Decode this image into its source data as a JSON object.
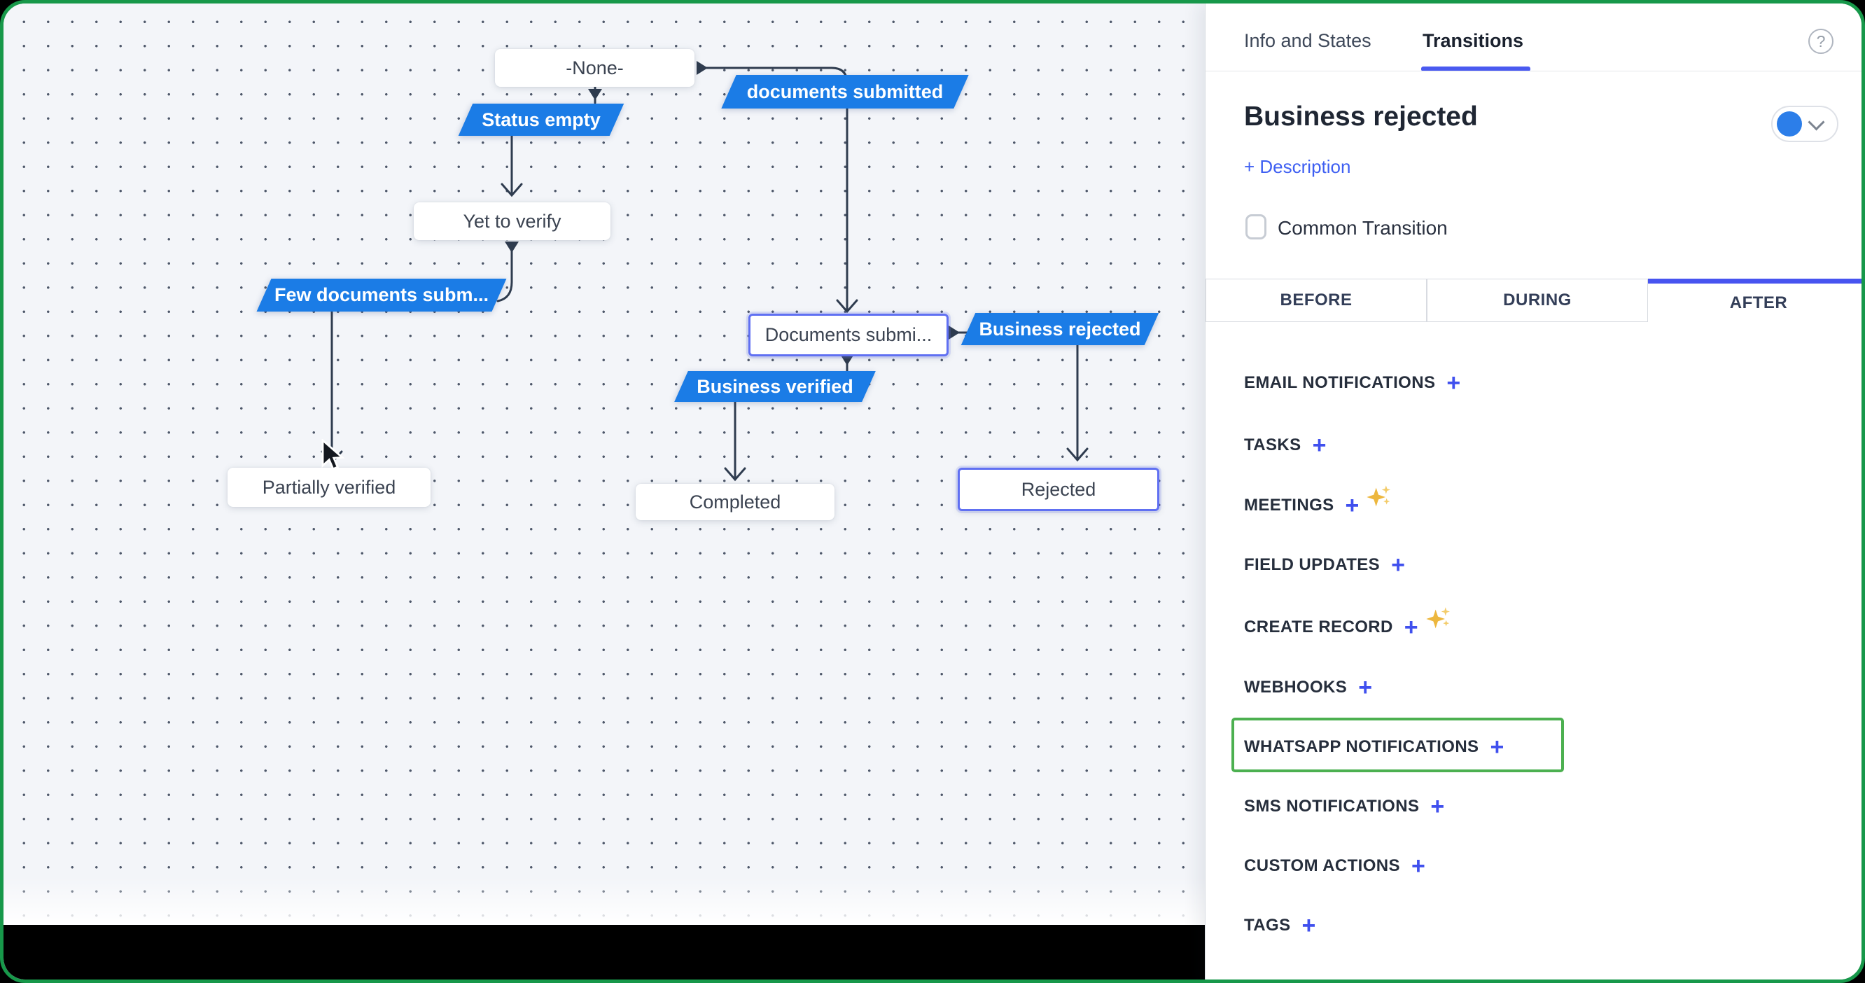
{
  "window": {
    "border_color": "#17984a"
  },
  "canvas": {
    "states": [
      {
        "label": "-None-"
      },
      {
        "label": "Yet to verify"
      },
      {
        "label": "Documents submi...",
        "selected": true
      },
      {
        "label": "Partially verified"
      },
      {
        "label": "Completed"
      },
      {
        "label": "Rejected",
        "selected": true
      }
    ],
    "transitions": [
      {
        "label": "Status empty"
      },
      {
        "label": "documents submitted"
      },
      {
        "label": "Few documents subm..."
      },
      {
        "label": "Business rejected"
      },
      {
        "label": "Business verified"
      }
    ],
    "colors": {
      "transition_bg": "#1b7ce6",
      "connector": "#2f3c4f"
    }
  },
  "panel": {
    "header_tabs": [
      {
        "label": "Info and States",
        "active": false
      },
      {
        "label": "Transitions",
        "active": true
      }
    ],
    "help_icon": "?",
    "title": "Business rejected",
    "description_link": "+ Description",
    "common_transition_label": "Common Transition",
    "common_transition_checked": false,
    "phase_tabs": [
      {
        "label": "BEFORE",
        "active": false
      },
      {
        "label": "DURING",
        "active": false
      },
      {
        "label": "AFTER",
        "active": true
      }
    ],
    "add_label": "+",
    "actions": [
      {
        "label": "EMAIL NOTIFICATIONS",
        "sparkle": false,
        "highlighted": false
      },
      {
        "label": "TASKS",
        "sparkle": false,
        "highlighted": false
      },
      {
        "label": "MEETINGS",
        "sparkle": true,
        "highlighted": false
      },
      {
        "label": "FIELD UPDATES",
        "sparkle": false,
        "highlighted": false
      },
      {
        "label": "CREATE RECORD",
        "sparkle": true,
        "highlighted": false
      },
      {
        "label": "WEBHOOKS",
        "sparkle": false,
        "highlighted": false
      },
      {
        "label": "WHATSAPP NOTIFICATIONS",
        "sparkle": false,
        "highlighted": true
      },
      {
        "label": "SMS NOTIFICATIONS",
        "sparkle": false,
        "highlighted": false
      },
      {
        "label": "CUSTOM ACTIONS",
        "sparkle": false,
        "highlighted": false
      },
      {
        "label": "TAGS",
        "sparkle": false,
        "highlighted": false
      }
    ],
    "colors": {
      "accent": "#4050ee",
      "active_tab": "#4754f0",
      "highlight_green": "#4cb050",
      "status_dot": "#2c7ee9"
    }
  }
}
